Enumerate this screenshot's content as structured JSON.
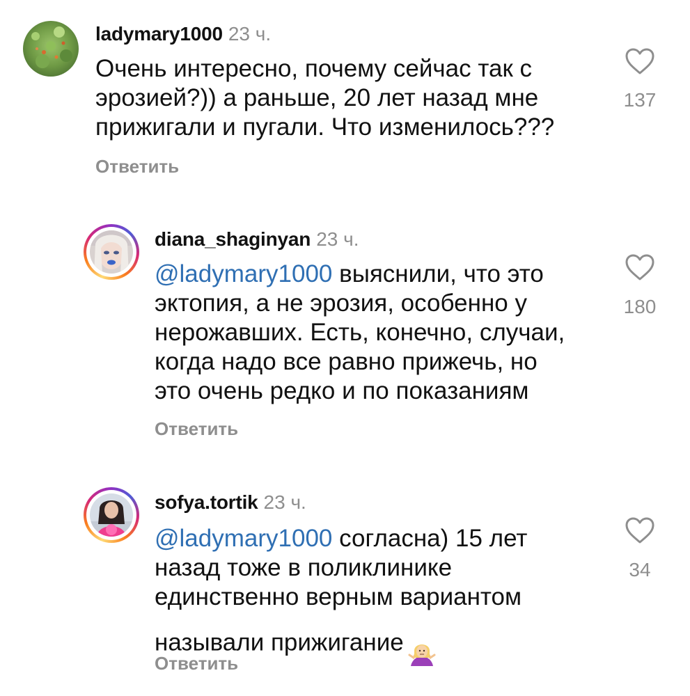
{
  "comments": [
    {
      "username": "ladymary1000",
      "time": "23 ч.",
      "mention": "",
      "text": "Очень интересно, почему сейчас так с\nэрозией?)) а раньше, 20 лет назад мне\nприжигали и пугали. Что изменилось???",
      "likes": "137",
      "reply_label": "Ответить"
    },
    {
      "username": "diana_shaginyan",
      "time": "23 ч.",
      "mention": "@ladymary1000",
      "text": " выяснили, что это\nэктопия, а не эрозия, особенно у\nнерожавших. Есть, конечно, случаи,\nкогда надо все равно прижечь, но\nэто очень редко и по показаниям",
      "likes": "180",
      "reply_label": "Ответить"
    },
    {
      "username": "sofya.tortik",
      "time": "23 ч.",
      "mention": "@ladymary1000",
      "text": " согласна) 15 лет\nназад тоже в поликлинике\nединственно верным вариантом\nназывали прижигание",
      "likes": "34",
      "reply_label": "Ответить",
      "emoji": "person-shrugging-emoji"
    }
  ],
  "colors": {
    "mention": "#2f6fb3",
    "muted": "#8e8e8e",
    "text": "#111111"
  }
}
